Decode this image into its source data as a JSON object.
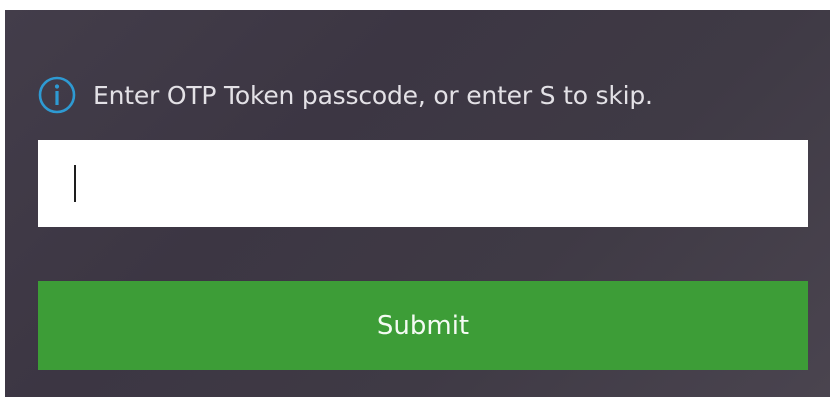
{
  "prompt": {
    "icon": "info-circle-icon",
    "text": "Enter OTP Token passcode, or enter S to skip."
  },
  "otp_field": {
    "value": "",
    "placeholder": ""
  },
  "submit": {
    "label": "Submit"
  },
  "colors": {
    "panel_background": "#3f3a45",
    "icon_accent": "#2e9ad3",
    "button_green": "#3d9d37",
    "prompt_text": "#e3e1e6"
  }
}
